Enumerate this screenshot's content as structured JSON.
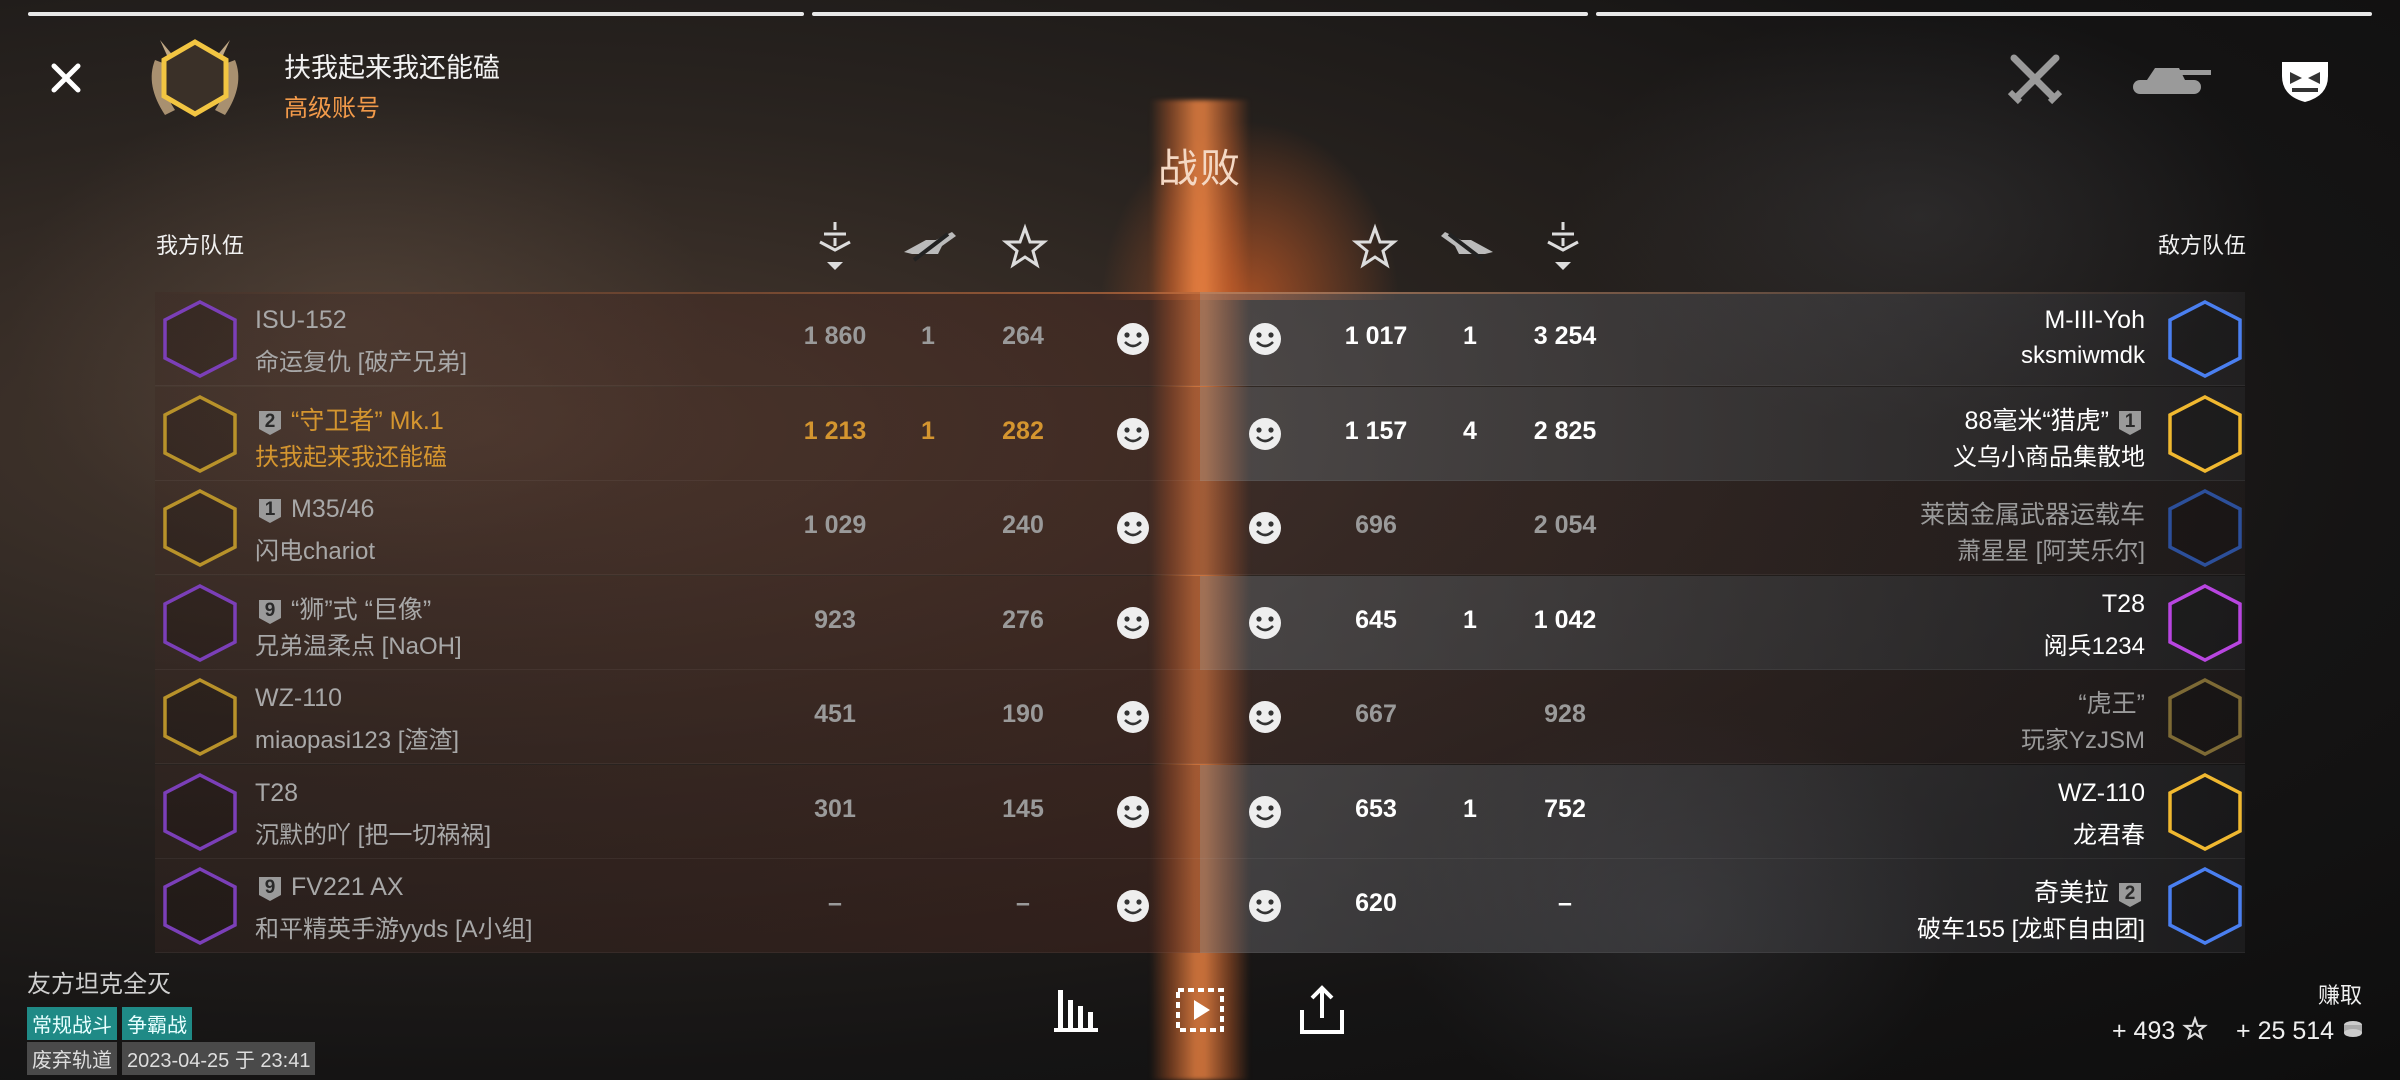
{
  "header": {
    "player_name": "扶我起来我还能磕",
    "account_type": "高级账号",
    "result": "战败",
    "close_icon": "close-icon",
    "top_icons": [
      "crossed-swords-icon",
      "tank-icon",
      "helmet-icon"
    ]
  },
  "teams": {
    "left_label": "我方队伍",
    "right_label": "敌方队伍"
  },
  "columns": {
    "left": [
      "damage-sort-icon",
      "kills-icon",
      "xp-star-icon"
    ],
    "right": [
      "xp-star-icon",
      "kills-icon",
      "damage-sort-icon"
    ]
  },
  "rows": [
    {
      "left": {
        "tank": "ISU-152",
        "nick": "命运复仇 [破产兄弟]",
        "badge": "",
        "damage": "1 860",
        "kills": "1",
        "xp": "264",
        "hex_color": "#7b3fb8",
        "style": "grey"
      },
      "right": {
        "tank": "M-III-Yoh",
        "nick": "sksmiwmdk",
        "badge": "",
        "damage": "3 254",
        "kills": "1",
        "xp": "1 017",
        "hex_color": "#4a7ff0",
        "style": "white"
      }
    },
    {
      "left": {
        "tank": "“守卫者” Mk.1",
        "nick": "扶我起来我还能磕",
        "badge": "2",
        "damage": "1 213",
        "kills": "1",
        "xp": "282",
        "hex_color": "#b8922a",
        "style": "gold"
      },
      "right": {
        "tank": "88毫米“猎虎”",
        "nick": "义乌小商品集散地",
        "badge": "1",
        "damage": "2 825",
        "kills": "4",
        "xp": "1 157",
        "hex_color": "#f0b830",
        "style": "white"
      }
    },
    {
      "left": {
        "tank": "M35/46",
        "nick": "闪电chariot",
        "badge": "1",
        "damage": "1 029",
        "kills": "",
        "xp": "240",
        "hex_color": "#b8922a",
        "style": "grey"
      },
      "right": {
        "tank": "莱茵金属武器运载车",
        "nick": "萧星星 [阿芙乐尔]",
        "badge": "",
        "damage": "2 054",
        "kills": "",
        "xp": "696",
        "hex_color": "#2c4f9a",
        "style": "dim"
      }
    },
    {
      "left": {
        "tank": "“狮”式 “巨像”",
        "nick": "兄弟温柔点 [NaOH]",
        "badge": "9",
        "damage": "923",
        "kills": "",
        "xp": "276",
        "hex_color": "#7b3fb8",
        "style": "grey"
      },
      "right": {
        "tank": "T28",
        "nick": "阅兵1234",
        "badge": "",
        "damage": "1 042",
        "kills": "1",
        "xp": "645",
        "hex_color": "#b845e0",
        "style": "white"
      }
    },
    {
      "left": {
        "tank": "WZ-110",
        "nick": "miaopasi123 [渣渣]",
        "badge": "",
        "damage": "451",
        "kills": "",
        "xp": "190",
        "hex_color": "#b8922a",
        "style": "grey"
      },
      "right": {
        "tank": "“虎王”",
        "nick": "玩家YzJSM",
        "badge": "",
        "damage": "928",
        "kills": "",
        "xp": "667",
        "hex_color": "#7d6a35",
        "style": "dim"
      }
    },
    {
      "left": {
        "tank": "T28",
        "nick": "沉默的吖 [把一切祸祸]",
        "badge": "",
        "damage": "301",
        "kills": "",
        "xp": "145",
        "hex_color": "#7b3fb8",
        "style": "grey"
      },
      "right": {
        "tank": "WZ-110",
        "nick": "龙君春",
        "badge": "",
        "damage": "752",
        "kills": "1",
        "xp": "653",
        "hex_color": "#f0b830",
        "style": "white"
      }
    },
    {
      "left": {
        "tank": "FV221 AX",
        "nick": "和平精英手游yyds [A小组]",
        "badge": "9",
        "damage": "–",
        "kills": "",
        "xp": "–",
        "hex_color": "#7b3fb8",
        "style": "grey"
      },
      "right": {
        "tank": "奇美拉",
        "nick": "破车155 [龙虾自由团]",
        "badge": "2",
        "damage": "–",
        "kills": "",
        "xp": "620",
        "hex_color": "#4a7ff0",
        "style": "white"
      }
    }
  ],
  "footer": {
    "reason": "友方坦克全灭",
    "mode_tags": [
      "常规战斗",
      "争霸战"
    ],
    "map": "废弃轨道",
    "datetime": "2023-04-25 于 23:41",
    "buttons": [
      "stats-chart-icon",
      "replay-icon",
      "share-icon"
    ],
    "earn_label": "赚取",
    "xp_earned": "+ 493",
    "credits_earned": "+ 25 514"
  }
}
